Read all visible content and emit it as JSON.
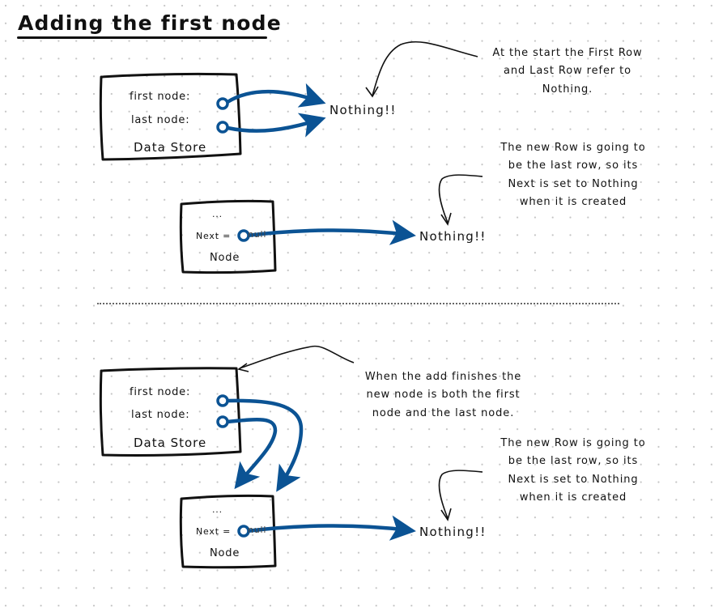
{
  "title": "Adding the first node",
  "colors": {
    "pointer": "#0b5394",
    "ink": "#111111",
    "grid_dot": "#c4c4c4"
  },
  "before": {
    "data_store": {
      "first_label": "first node:",
      "last_label": "last node:",
      "name": "Data Store"
    },
    "nothing_label": "Nothing!!",
    "note_start": [
      "At the start the First Row",
      "and Last Row refer to",
      "Nothing."
    ],
    "node": {
      "ellipsis": "...",
      "next_label": "Next =",
      "null_value": "null",
      "name": "Node"
    },
    "node_nothing_label": "Nothing!!",
    "note_new_row": [
      "The new Row is going to",
      "be the last row, so its",
      "Next is set to Nothing",
      "when it is created"
    ]
  },
  "after": {
    "data_store": {
      "first_label": "first node:",
      "last_label": "last node:",
      "name": "Data Store"
    },
    "note_finish": [
      "When the add finishes the",
      "new node is both the first",
      "node and the last node."
    ],
    "node": {
      "ellipsis": "...",
      "next_label": "Next =",
      "null_value": "null",
      "name": "Node"
    },
    "node_nothing_label": "Nothing!!",
    "note_new_row": [
      "The new Row is going to",
      "be the last row, so its",
      "Next is set to Nothing",
      "when it is created"
    ]
  }
}
